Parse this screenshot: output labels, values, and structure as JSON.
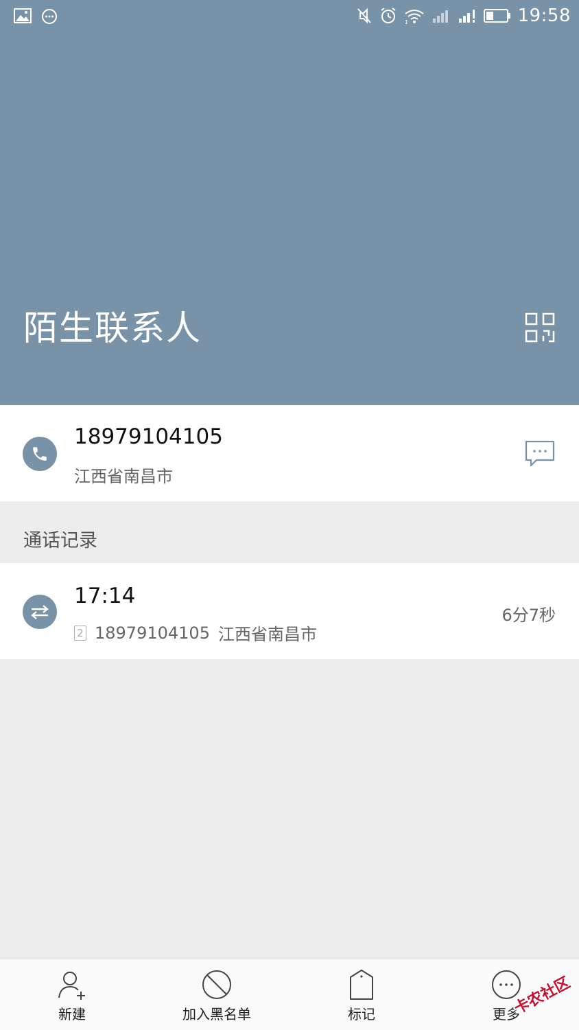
{
  "statusbar": {
    "time": "19:58",
    "left_icons": [
      "image-icon",
      "chat-bubble-icon"
    ],
    "right_icons": [
      "mute-icon",
      "alarm-icon",
      "wifi-icon",
      "signal-sim1-icon",
      "signal-sim2-icon",
      "battery-icon"
    ]
  },
  "header": {
    "title": "陌生联系人",
    "background": "#7892a7"
  },
  "number_card": {
    "number": "18979104105",
    "location": "江西省南昌市"
  },
  "call_log": {
    "section_title": "通话记录",
    "entries": [
      {
        "time": "17:14",
        "sim": "2",
        "number": "18979104105",
        "location": "江西省南昌市",
        "duration": "6分7秒"
      }
    ]
  },
  "toolbar": {
    "items": [
      {
        "label": "新建",
        "icon": "add-contact-icon"
      },
      {
        "label": "加入黑名单",
        "icon": "block-icon"
      },
      {
        "label": "标记",
        "icon": "tag-icon"
      },
      {
        "label": "更多",
        "icon": "more-icon"
      }
    ]
  },
  "watermark": {
    "text": "卡农社区"
  },
  "colors": {
    "accent": "#7892a7",
    "page_bg": "#ededed",
    "card_bg": "#ffffff"
  }
}
